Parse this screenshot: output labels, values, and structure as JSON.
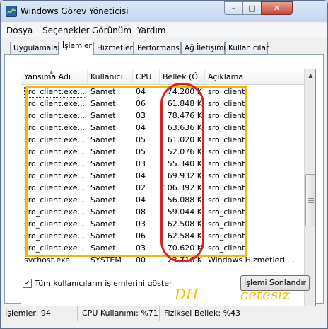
{
  "window": {
    "title": "Windows Görev Yöneticisi"
  },
  "controls": {
    "minimize": "–",
    "maximize": "□",
    "close": "✕"
  },
  "menu": [
    "Dosya",
    "Seçenekler",
    "Görünüm",
    "Yardım"
  ],
  "tabs": [
    "Uygulamalar",
    "İşlemler",
    "Hizmetler",
    "Performans",
    "Ağ İletişimi",
    "Kullanıcılar"
  ],
  "active_tab": "İşlemler",
  "columns": [
    "Yansıma Adı",
    "Kullanıcı ...",
    "CPU",
    "Bellek (Ö...",
    "Açıklama"
  ],
  "rows": [
    {
      "name": "sro_client.exe...",
      "user": "Samet",
      "cpu": "04",
      "mem": "74.200 K",
      "desc": "sro_client"
    },
    {
      "name": "sro_client.exe...",
      "user": "Samet",
      "cpu": "06",
      "mem": "61.848 K",
      "desc": "sro_client"
    },
    {
      "name": "sro_client.exe...",
      "user": "Samet",
      "cpu": "03",
      "mem": "78.476 K",
      "desc": "sro_client"
    },
    {
      "name": "sro_client.exe...",
      "user": "Samet",
      "cpu": "04",
      "mem": "63.636 K",
      "desc": "sro_client"
    },
    {
      "name": "sro_client.exe...",
      "user": "Samet",
      "cpu": "05",
      "mem": "61.020 K",
      "desc": "sro_client"
    },
    {
      "name": "sro_client.exe...",
      "user": "Samet",
      "cpu": "05",
      "mem": "52.076 K",
      "desc": "sro_client"
    },
    {
      "name": "sro_client.exe...",
      "user": "Samet",
      "cpu": "03",
      "mem": "55.340 K",
      "desc": "sro_client"
    },
    {
      "name": "sro_client.exe...",
      "user": "Samet",
      "cpu": "04",
      "mem": "69.932 K",
      "desc": "sro_client"
    },
    {
      "name": "sro_client.exe...",
      "user": "Samet",
      "cpu": "02",
      "mem": "106.392 K",
      "desc": "sro_client"
    },
    {
      "name": "sro_client.exe...",
      "user": "Samet",
      "cpu": "04",
      "mem": "56.088 K",
      "desc": "sro_client"
    },
    {
      "name": "sro_client.exe...",
      "user": "Samet",
      "cpu": "08",
      "mem": "59.044 K",
      "desc": "sro_client"
    },
    {
      "name": "sro_client.exe...",
      "user": "Samet",
      "cpu": "03",
      "mem": "62.508 K",
      "desc": "sro_client"
    },
    {
      "name": "sro_client.exe...",
      "user": "Samet",
      "cpu": "06",
      "mem": "62.584 K",
      "desc": "sro_client"
    },
    {
      "name": "sro_client.exe...",
      "user": "Samet",
      "cpu": "03",
      "mem": "70.620 K",
      "desc": "sro_client"
    },
    {
      "name": "svchost.exe",
      "user": "SYSTEM",
      "cpu": "00",
      "mem": "23.716 K",
      "desc": "Windows Hizmetleri ..."
    }
  ],
  "show_all_users_label": "Tüm kullanıcıların işlemlerini göster",
  "show_all_users_checked": "✓",
  "end_process_label": "İşlemi Sonlandır",
  "overlay": {
    "left": "DH",
    "right": "cetesiz"
  },
  "status": {
    "processes": "İşlemler: 94",
    "cpu": "CPU Kullanımı: %71",
    "memory": "Fiziksel Bellek: %43"
  },
  "colors": {
    "highlight_box": "#f5b800",
    "highlight_ellipse": "#e02020",
    "overlay_text": "#f5c000"
  }
}
